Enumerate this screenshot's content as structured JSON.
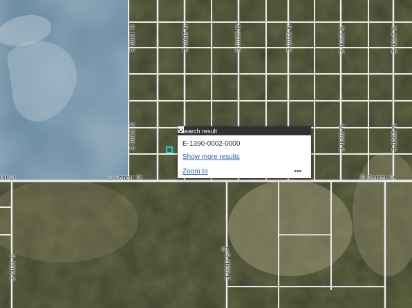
{
  "map": {
    "street_labels": {
      "n1900": "N 1900 E",
      "n2000": "N 2000 E",
      "n2100": "N 2100 E",
      "n2200": "N 2200 E",
      "n2300": "N 2300 E",
      "n2400": "N 2400 E",
      "n2800": "N 2800 E",
      "n2900": "N 2900 E",
      "n2100b": "N 2100 E",
      "n2800b": "N 2800 E",
      "n2900b": "N 2900 E",
      "center_left": "E Center St",
      "center_right": "E Center St",
      "left_edge": "00 St",
      "s2600": "S 2600 E",
      "s1200": "S 1200 E",
      "num01": "01"
    },
    "colors": {
      "lake": "#6f8fa6",
      "terrain": "#616646",
      "road": "#ececec",
      "marker": "#12d6c2"
    }
  },
  "popup": {
    "title": "Search result",
    "maximize_icon": "maximize-icon",
    "close_icon": "close-icon",
    "result_id": "E-1390-0002-0000",
    "show_more": "Show more results",
    "zoom_to": "Zoom to",
    "more_options": "•••"
  }
}
